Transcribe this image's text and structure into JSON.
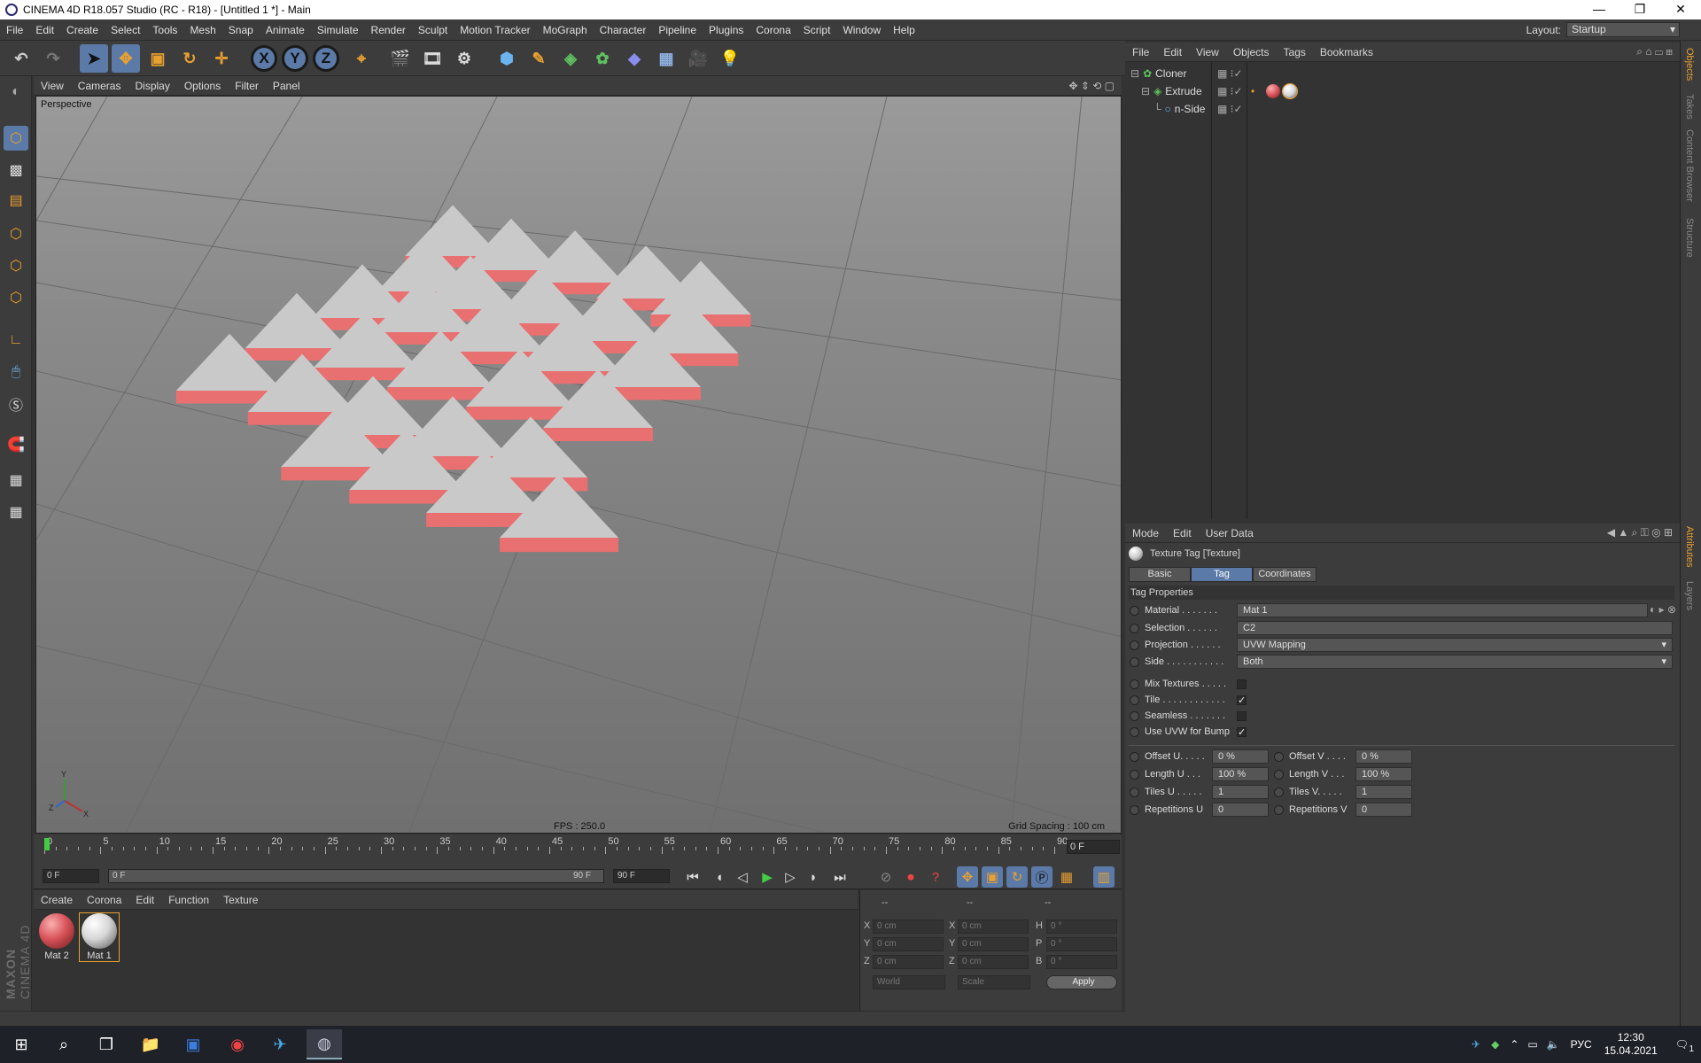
{
  "window": {
    "title": "CINEMA 4D R18.057 Studio (RC - R18) - [Untitled 1 *] - Main",
    "minimize": "—",
    "maximize": "❐",
    "close": "✕"
  },
  "menubar": {
    "items": [
      "File",
      "Edit",
      "Create",
      "Select",
      "Tools",
      "Mesh",
      "Snap",
      "Animate",
      "Simulate",
      "Render",
      "Sculpt",
      "Motion Tracker",
      "MoGraph",
      "Character",
      "Pipeline",
      "Plugins",
      "Corona",
      "Script",
      "Window",
      "Help"
    ],
    "layout_label": "Layout:",
    "layout_value": "Startup"
  },
  "toolbar": {
    "axis": [
      "X",
      "Y",
      "Z"
    ]
  },
  "viewport": {
    "menu": [
      "View",
      "Cameras",
      "Display",
      "Options",
      "Filter",
      "Panel"
    ],
    "label": "Perspective",
    "fps": "FPS : 250.0",
    "grid_spacing": "Grid Spacing : 100 cm",
    "axis_y": "Y",
    "axis_x": "X",
    "axis_z": "Z"
  },
  "timeline": {
    "ticks": [
      "0",
      "5",
      "10",
      "15",
      "20",
      "25",
      "30",
      "35",
      "40",
      "45",
      "50",
      "55",
      "60",
      "65",
      "70",
      "75",
      "80",
      "85",
      "90"
    ],
    "current": "0 F",
    "start": "0 F",
    "range_start": "0 F",
    "range_end": "90 F",
    "end": "90 F"
  },
  "materials": {
    "menu": [
      "Create",
      "Corona",
      "Edit",
      "Function",
      "Texture"
    ],
    "items": [
      {
        "name": "Mat 2",
        "color": "#d9535a"
      },
      {
        "name": "Mat 1",
        "color": "#e6e6e6"
      }
    ],
    "brand_top": "MAXON",
    "brand_bottom": "CINEMA 4D"
  },
  "coords": {
    "headers": [
      "--",
      "--",
      "--"
    ],
    "rows": [
      {
        "a": "X",
        "av": "0 cm",
        "b": "X",
        "bv": "0 cm",
        "c": "H",
        "cv": "0 °"
      },
      {
        "a": "Y",
        "av": "0 cm",
        "b": "Y",
        "bv": "0 cm",
        "c": "P",
        "cv": "0 °"
      },
      {
        "a": "Z",
        "av": "0 cm",
        "b": "Z",
        "bv": "0 cm",
        "c": "B",
        "cv": "0 °"
      }
    ],
    "world": "World",
    "scale": "Scale",
    "apply": "Apply"
  },
  "objects": {
    "menu": [
      "File",
      "Edit",
      "View",
      "Objects",
      "Tags",
      "Bookmarks"
    ],
    "tree": [
      {
        "name": "Cloner"
      },
      {
        "name": "Extrude"
      },
      {
        "name": "n-Side"
      }
    ]
  },
  "attributes": {
    "menu": [
      "Mode",
      "Edit",
      "User Data"
    ],
    "title": "Texture Tag [Texture]",
    "tabs": [
      "Basic",
      "Tag",
      "Coordinates"
    ],
    "section": "Tag Properties",
    "material_label": "Material . . . . . . .",
    "material_value": "Mat 1",
    "selection_label": "Selection . . . . . .",
    "selection_value": "C2",
    "projection_label": "Projection . . . . . .",
    "projection_value": "UVW Mapping",
    "side_label": "Side . . . . . . . . . . .",
    "side_value": "Both",
    "mix_label": "Mix Textures . . . . .",
    "tile_label": "Tile . . . . . . . . . . . .",
    "seamless_label": "Seamless . . . . . . .",
    "uvwbump_label": "Use UVW for Bump",
    "offsetu_label": "Offset U. . . . .",
    "offsetu": "0 %",
    "offsetv_label": "Offset V . . . .",
    "offsetv": "0 %",
    "lengthu_label": "Length U . . .",
    "lengthu": "100 %",
    "lengthv_label": "Length V . . .",
    "lengthv": "100 %",
    "tilesu_label": "Tiles U . . . . .",
    "tilesu": "1",
    "tilesv_label": "Tiles V. . . . .",
    "tilesv": "1",
    "repu_label": "Repetitions U",
    "repu": "0",
    "repv_label": "Repetitions V",
    "repv": "0",
    "check": "✓"
  },
  "sidetabs": [
    "Objects",
    "Takes",
    "Content Browser",
    "Structure",
    "Attributes",
    "Layers"
  ],
  "taskbar": {
    "lang": "РУС",
    "time": "12:30",
    "date": "15.04.2021",
    "notif": "1"
  }
}
